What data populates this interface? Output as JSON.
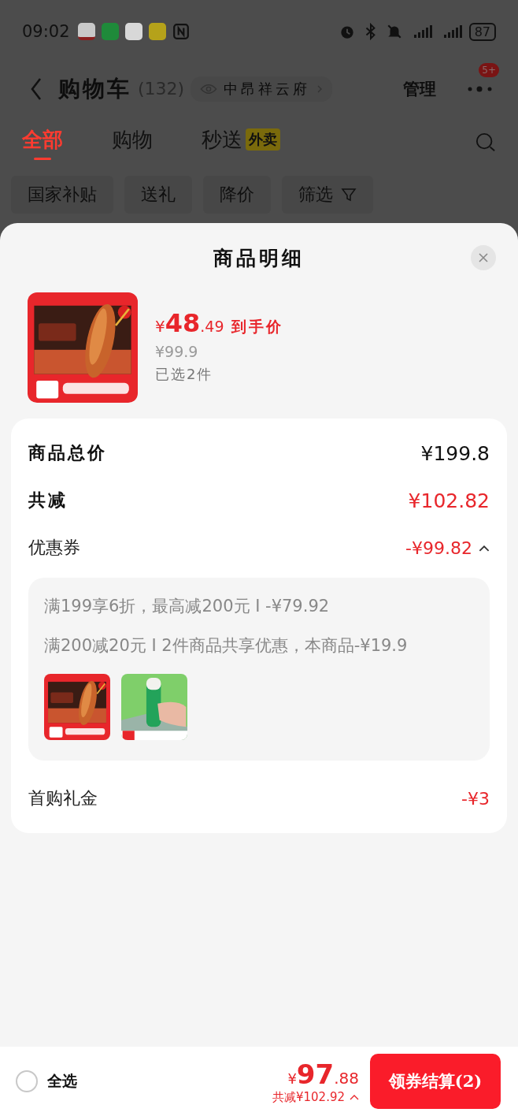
{
  "status_bar": {
    "time": "09:02",
    "battery": "87"
  },
  "header": {
    "title": "购物车",
    "count": "(132)",
    "address": "中昂祥云府",
    "manage": "管理",
    "badge": "5+"
  },
  "tabs": [
    {
      "label": "全部",
      "selected": true
    },
    {
      "label": "购物",
      "selected": false
    },
    {
      "label": "秒送",
      "selected": false,
      "tag": "外卖"
    }
  ],
  "filters": [
    {
      "label": "国家补贴"
    },
    {
      "label": "送礼"
    },
    {
      "label": "降价"
    },
    {
      "label": "筛选",
      "kind": "filter"
    }
  ],
  "sheet": {
    "title": "商品明细",
    "product": {
      "image": {
        "kind": "picture"
      },
      "currency": "¥",
      "price_int": "48",
      "price_dec": ".49",
      "price_label": "到手价",
      "original_price": "¥99.9",
      "selected_count": "已选2件"
    },
    "summary": [
      {
        "kind": "total",
        "label": "商品总价",
        "value": "¥199.8"
      },
      {
        "kind": "discount",
        "label": "共减",
        "value": "¥102.82"
      },
      {
        "kind": "coupon",
        "label": "优惠券",
        "value": "-¥99.82",
        "expanded": true,
        "details": [
          "满199享6折，最高减200元 I -¥79.92",
          "满200减20元 I 2件商品共享优惠，本商品-¥19.9"
        ],
        "images": [
          {
            "kind": "picture"
          },
          {
            "kind": "picture"
          }
        ]
      },
      {
        "kind": "gift",
        "label": "首购礼金",
        "value": "-¥3"
      }
    ]
  },
  "bottom_bar": {
    "select_all": {
      "label": "全选",
      "checked": false
    },
    "currency": "¥",
    "price_int": "97",
    "price_dec": ".88",
    "saved": "共减¥102.92",
    "checkout": "领券结算(2)"
  }
}
